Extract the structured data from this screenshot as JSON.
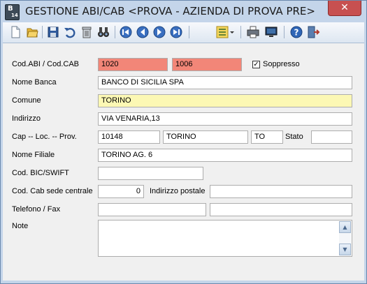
{
  "window": {
    "title": "GESTIONE ABI/CAB <PROVA - AZIENDA DI PROVA PRE>",
    "app_icon_text": "B",
    "app_icon_sub": "14",
    "close_glyph": "✕"
  },
  "toolbar": {
    "icons": [
      "new-document-icon",
      "open-folder-icon",
      "save-icon",
      "undo-icon",
      "delete-icon",
      "search-binoculars-icon",
      "first-record-icon",
      "previous-record-icon",
      "next-record-icon",
      "last-record-icon",
      "list-options-icon",
      "print-icon",
      "screen-preview-icon",
      "help-icon",
      "exit-icon"
    ]
  },
  "form": {
    "abi_cab_label": "Cod.ABI / Cod.CAB",
    "abi_value": "1020",
    "cab_value": "1006",
    "soppresso_label": "Soppresso",
    "soppresso_checked": "✓",
    "nome_banca_label": "Nome Banca",
    "nome_banca_value": "BANCO DI SICILIA SPA",
    "comune_label": "Comune",
    "comune_value": "TORINO",
    "indirizzo_label": "Indirizzo",
    "indirizzo_value": "VIA VENARIA,13",
    "cap_label": "Cap -- Loc. -- Prov.",
    "cap_value": "10148",
    "localita_value": "TORINO",
    "provincia_value": "TO",
    "stato_label": "Stato",
    "stato_value": "",
    "filiale_label": "Nome Filiale",
    "filiale_value": "TORINO AG. 6",
    "bic_label": "Cod. BIC/SWIFT",
    "bic_value": "",
    "cab_sede_label": "Cod. Cab sede centrale",
    "cab_sede_value": "0",
    "indirizzo_postale_label": "Indirizzo postale",
    "indirizzo_postale_value": "",
    "telefono_label": "Telefono / Fax",
    "telefono_value": "",
    "fax_value": "",
    "note_label": "Note",
    "note_value": ""
  },
  "colors": {
    "required_field": "#f28678",
    "highlight_field": "#fcf8b4",
    "close_button": "#c75050"
  }
}
